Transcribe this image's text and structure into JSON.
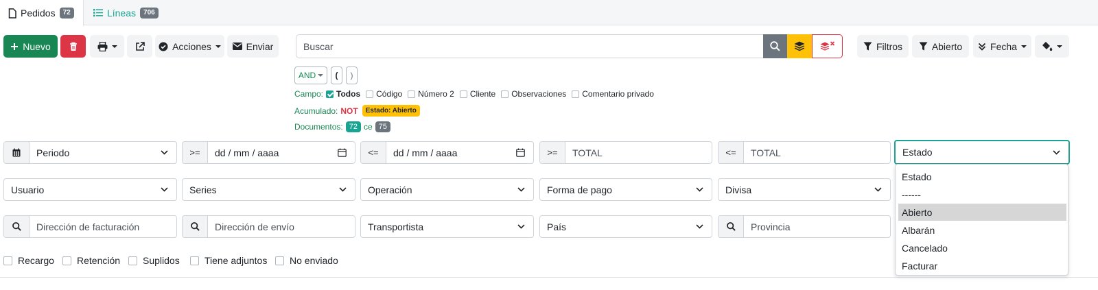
{
  "tabs": [
    {
      "label": "Pedidos",
      "count": "72"
    },
    {
      "label": "Líneas",
      "count": "706"
    }
  ],
  "toolbar": {
    "new_label": "Nuevo",
    "actions_label": "Acciones",
    "send_label": "Enviar",
    "filters_label": "Filtros",
    "open_label": "Abierto",
    "date_label": "Fecha"
  },
  "search": {
    "placeholder": "Buscar"
  },
  "logic": {
    "and_label": "AND",
    "open_paren": "(",
    "close_paren": ")"
  },
  "campo": {
    "label": "Campo:",
    "options": [
      {
        "label": "Todos",
        "checked": true
      },
      {
        "label": "Código",
        "checked": false
      },
      {
        "label": "Número 2",
        "checked": false
      },
      {
        "label": "Cliente",
        "checked": false
      },
      {
        "label": "Observaciones",
        "checked": false
      },
      {
        "label": "Comentario privado",
        "checked": false
      }
    ]
  },
  "acumulado": {
    "label": "Acumulado:",
    "not_label": "NOT",
    "badge": "Estado: Abierto"
  },
  "documentos": {
    "label": "Documentos:",
    "count": "72",
    "connector": "ce",
    "total": "75"
  },
  "filters": {
    "row1": {
      "period_label": "Periodo",
      "gte_symbol": ">=",
      "lte_symbol": "<=",
      "date_placeholder": "dd / mm / aaaa",
      "total_placeholder": "TOTAL",
      "status_label": "Estado"
    },
    "row2": {
      "user_label": "Usuario",
      "series_label": "Series",
      "operation_label": "Operación",
      "payment_label": "Forma de pago",
      "currency_label": "Divisa"
    },
    "row3": {
      "billing_placeholder": "Dirección de facturación",
      "shipping_placeholder": "Dirección de envío",
      "carrier_label": "Transportista",
      "country_label": "País",
      "province_placeholder": "Provincia"
    }
  },
  "status_dropdown": {
    "options": [
      "Estado",
      "------",
      "Abierto",
      "Albarán",
      "Cancelado",
      "Facturar"
    ],
    "selected": "Abierto"
  },
  "bottom_checks": [
    "Recargo",
    "Retención",
    "Suplidos",
    "Tiene adjuntos",
    "No enviado"
  ],
  "colors": {
    "primary_green": "#198754",
    "teal": "#1aa392",
    "danger": "#dc3545",
    "warning": "#ffc107",
    "secondary": "#6c757d"
  }
}
